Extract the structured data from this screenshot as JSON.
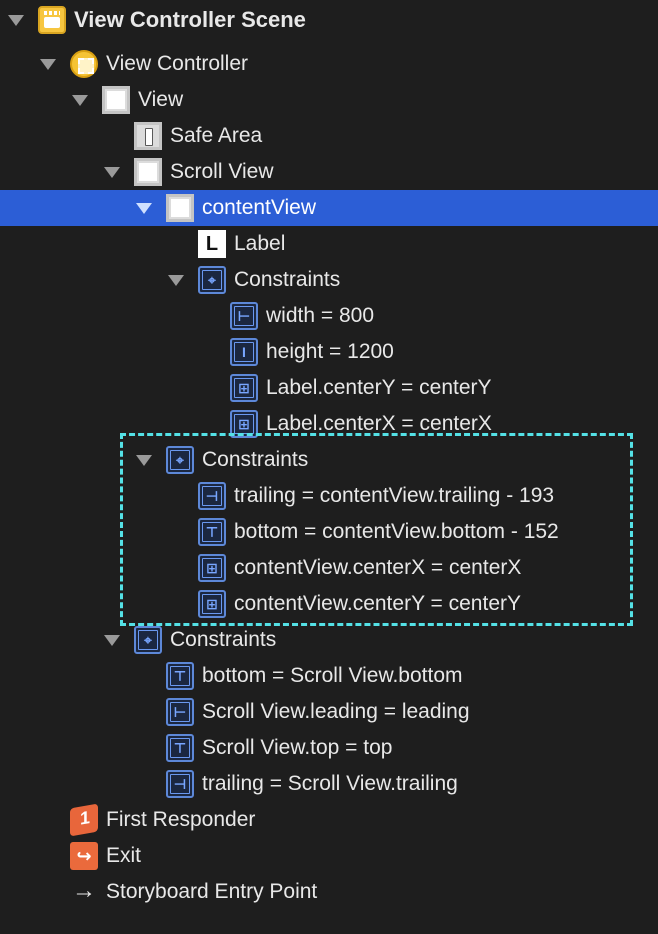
{
  "outline": [
    {
      "label": "View Controller Scene",
      "icon": "storyboard-scene-icon",
      "expanded": true,
      "bold": true
    },
    {
      "label": "View Controller",
      "icon": "view-controller-icon",
      "expanded": true
    },
    {
      "label": "View",
      "icon": "view-icon",
      "expanded": true
    },
    {
      "label": "Safe Area",
      "icon": "safe-area-icon"
    },
    {
      "label": "Scroll View",
      "icon": "scroll-view-icon",
      "expanded": true
    },
    {
      "label": "contentView",
      "icon": "view-icon",
      "expanded": true,
      "selected": true
    },
    {
      "label": "Label",
      "icon": "label-icon"
    },
    {
      "label": "Constraints",
      "icon": "constraints-icon",
      "expanded": true
    },
    {
      "label": "width = 800",
      "icon": "width-constraint-icon"
    },
    {
      "label": "height = 1200",
      "icon": "height-constraint-icon"
    },
    {
      "label": "Label.centerY = centerY",
      "icon": "center-y-constraint-icon"
    },
    {
      "label": "Label.centerX = centerX",
      "icon": "center-x-constraint-icon"
    },
    {
      "label": "Constraints",
      "icon": "constraints-icon",
      "expanded": true
    },
    {
      "label": "trailing = contentView.trailing - 193",
      "icon": "trailing-constraint-icon"
    },
    {
      "label": "bottom = contentView.bottom - 152",
      "icon": "bottom-constraint-icon"
    },
    {
      "label": "contentView.centerX = centerX",
      "icon": "center-x-constraint-icon"
    },
    {
      "label": "contentView.centerY = centerY",
      "icon": "center-y-constraint-icon"
    },
    {
      "label": "Constraints",
      "icon": "constraints-icon",
      "expanded": true
    },
    {
      "label": "bottom = Scroll View.bottom",
      "icon": "bottom-constraint-icon"
    },
    {
      "label": "Scroll View.leading = leading",
      "icon": "leading-constraint-icon"
    },
    {
      "label": "Scroll View.top = top",
      "icon": "top-constraint-icon"
    },
    {
      "label": "trailing = Scroll View.trailing",
      "icon": "trailing-constraint-icon"
    },
    {
      "label": "First Responder",
      "icon": "first-responder-icon"
    },
    {
      "label": "Exit",
      "icon": "exit-icon"
    },
    {
      "label": "Storyboard Entry Point",
      "icon": "entry-point-arrow-icon"
    }
  ],
  "colors": {
    "background": "#1e1e1e",
    "selection": "#2c5ed6",
    "highlight_dash": "#54e1e6"
  }
}
